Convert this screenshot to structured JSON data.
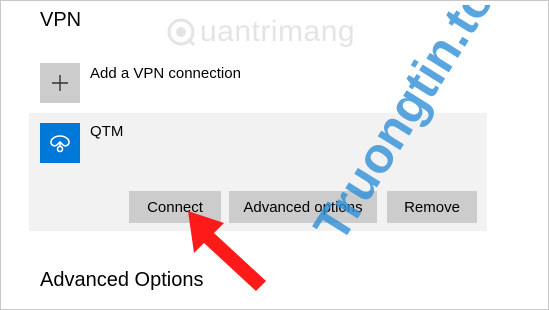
{
  "vpn_section": {
    "title": "VPN",
    "add_connection_label": "Add a VPN connection"
  },
  "connection": {
    "name": "QTM",
    "buttons": {
      "connect": "Connect",
      "advanced_options": "Advanced options",
      "remove": "Remove"
    }
  },
  "advanced_section": {
    "title": "Advanced Options"
  },
  "watermarks": {
    "brand": "uantrimang",
    "site": "Truongtin.top"
  },
  "colors": {
    "accent": "#0078d7",
    "tile_gray": "#cccccc",
    "card_bg": "#f2f2f2",
    "arrow_red": "#ff1a1a",
    "site_watermark_blue": "#2f8fd8",
    "site_watermark_orange": "#f47a20"
  },
  "icons": {
    "add": "plus-icon",
    "vpn": "vpn-icon",
    "annotation": "red-arrow"
  }
}
